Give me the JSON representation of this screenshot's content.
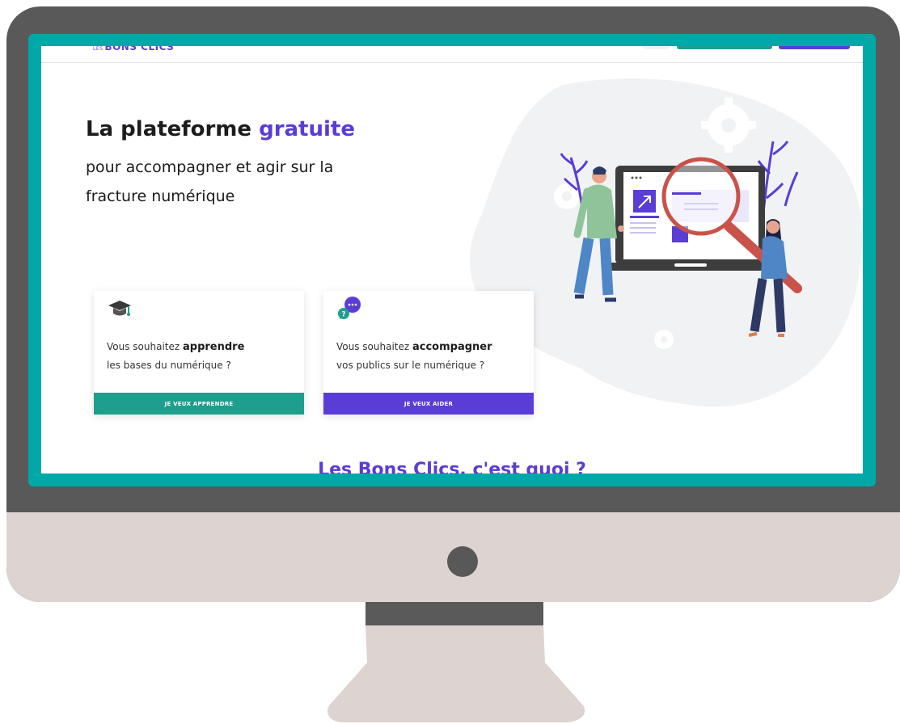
{
  "header": {
    "logo_prefix": "LES",
    "logo_name": "BONS CLICS"
  },
  "hero": {
    "title_start": "La plateforme ",
    "title_accent": "gratuite",
    "subtitle_line1": "pour accompagner et agir sur la",
    "subtitle_line2": "fracture numérique"
  },
  "cards": [
    {
      "intro": "Vous souhaitez ",
      "verb": "apprendre",
      "line2": "les bases du numérique ?",
      "button": "JE VEUX APPRENDRE",
      "icon": "graduation-cap-icon"
    },
    {
      "intro": "Vous souhaitez ",
      "verb": "accompagner",
      "line2": "vos publics sur le numérique ?",
      "button": "JE VEUX AIDER",
      "icon": "chat-question-icon"
    }
  ],
  "section": {
    "title": "Les Bons Clics, c'est quoi ?"
  },
  "colors": {
    "brand_purple": "#5a3dd6",
    "brand_teal": "#1e9e8c",
    "frame_teal": "#00a8a8",
    "bezel": "#595959",
    "chin": "#ddd3d1"
  }
}
